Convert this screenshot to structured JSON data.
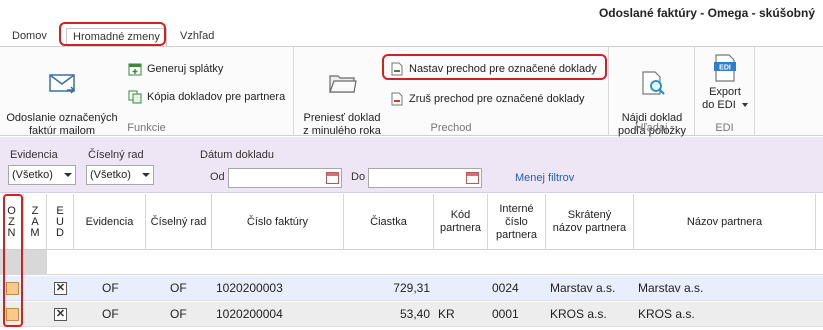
{
  "window": {
    "title": "Odoslané faktúry - Omega - skúšobný"
  },
  "tabs": [
    {
      "label": "Domov"
    },
    {
      "label": "Hromadné zmeny"
    },
    {
      "label": "Vzhľad"
    }
  ],
  "ribbon": {
    "funkcie": {
      "label": "Funkcie",
      "send_mail": "Odoslanie označených\nfaktúr mailom",
      "gen_installments": "Generuj splátky",
      "copy_docs": "Kópia dokladov pre partnera"
    },
    "prechod": {
      "label": "Prechod",
      "transfer_prev_year": "Preniesť doklad\nz minulého roka",
      "set_transfer": "Nastav prechod pre označené doklady",
      "cancel_transfer": "Zruš prechod pre označené doklady"
    },
    "hladaj": {
      "label": "Hľadaj",
      "find_by_item": "Nájdi doklad\npodľa položky"
    },
    "edi": {
      "label": "EDI",
      "export": "Export\ndo EDI",
      "icon_text": "EDI"
    }
  },
  "filters": {
    "evidencia_label": "Evidencia",
    "evidencia_value": "(Všetko)",
    "rad_label": "Číselný rad",
    "rad_value": "(Všetko)",
    "date_label": "Dátum dokladu",
    "od_label": "Od",
    "do_label": "Do",
    "less_filters": "Menej filtrov"
  },
  "grid": {
    "columns": {
      "ozn": [
        "O",
        "Z",
        "N"
      ],
      "zam": [
        "Z",
        "A",
        "M"
      ],
      "eud": [
        "E",
        "U",
        "D"
      ],
      "evidencia": "Evidencia",
      "rad": "Číselný rad",
      "cislo": "Číslo faktúry",
      "ciastka": "Čiastka",
      "kod": "Kód\npartnera",
      "interne": "Interné\nčíslo\npartnera",
      "skratene": "Skrátený\nnázov partnera",
      "nazov": "Názov partnera"
    },
    "rows": [
      {
        "evidencia": "OF",
        "rad": "OF",
        "cislo": "1020200003",
        "ciastka": "729,31",
        "kod": "",
        "interne": "0024",
        "skratene": "Marstav a.s.",
        "nazov": "Marstav a.s.",
        "ozn": false,
        "eud": true
      },
      {
        "evidencia": "OF",
        "rad": "OF",
        "cislo": "1020200004",
        "ciastka": "53,40",
        "kod": "KR",
        "interne": "0001",
        "skratene": "KROS a.s.",
        "nazov": "KROS a.s.",
        "ozn": false,
        "eud": true
      }
    ]
  },
  "colors": {
    "highlight": "#d62020",
    "filter_bg": "#eee6f4",
    "link": "#1f5fb5"
  }
}
